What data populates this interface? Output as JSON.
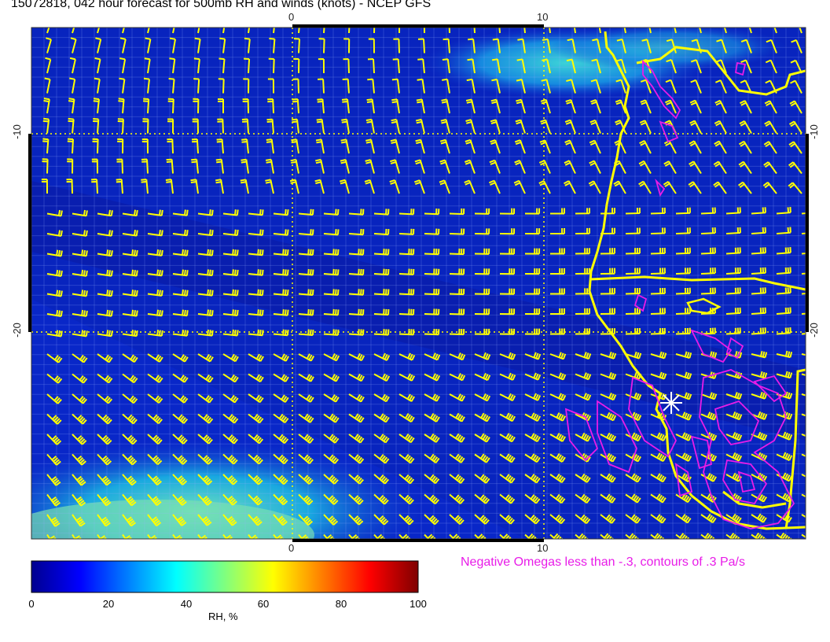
{
  "title": "15072818, 042 hour forecast for 500mb RH and winds (knots) - NCEP GFS",
  "axes": {
    "top_ticks": [
      "0",
      "10"
    ],
    "bottom_ticks": [
      "0",
      "10"
    ],
    "left_ticks": [
      "-10",
      "-20"
    ],
    "right_ticks": [
      "-10",
      "-20"
    ]
  },
  "omega_note": "Negative Omegas less than -.3, contours of .3 Pa/s",
  "colorbar": {
    "labels": [
      "0",
      "20",
      "40",
      "60",
      "80",
      "100"
    ],
    "title": "RH, %"
  },
  "colors": {
    "barb": "#ffff00",
    "coast": "#ffff00",
    "omega": "#e81ce8",
    "grid": "#ffff00",
    "rh_low": "#00008f",
    "rh_high": "#7f0000"
  },
  "chart_data": {
    "type": "heatmap",
    "field": "500mb relative humidity",
    "units": "%",
    "range": [
      0,
      100
    ],
    "overlay": [
      "wind barbs (knots)",
      "negative omega contours"
    ]
  }
}
